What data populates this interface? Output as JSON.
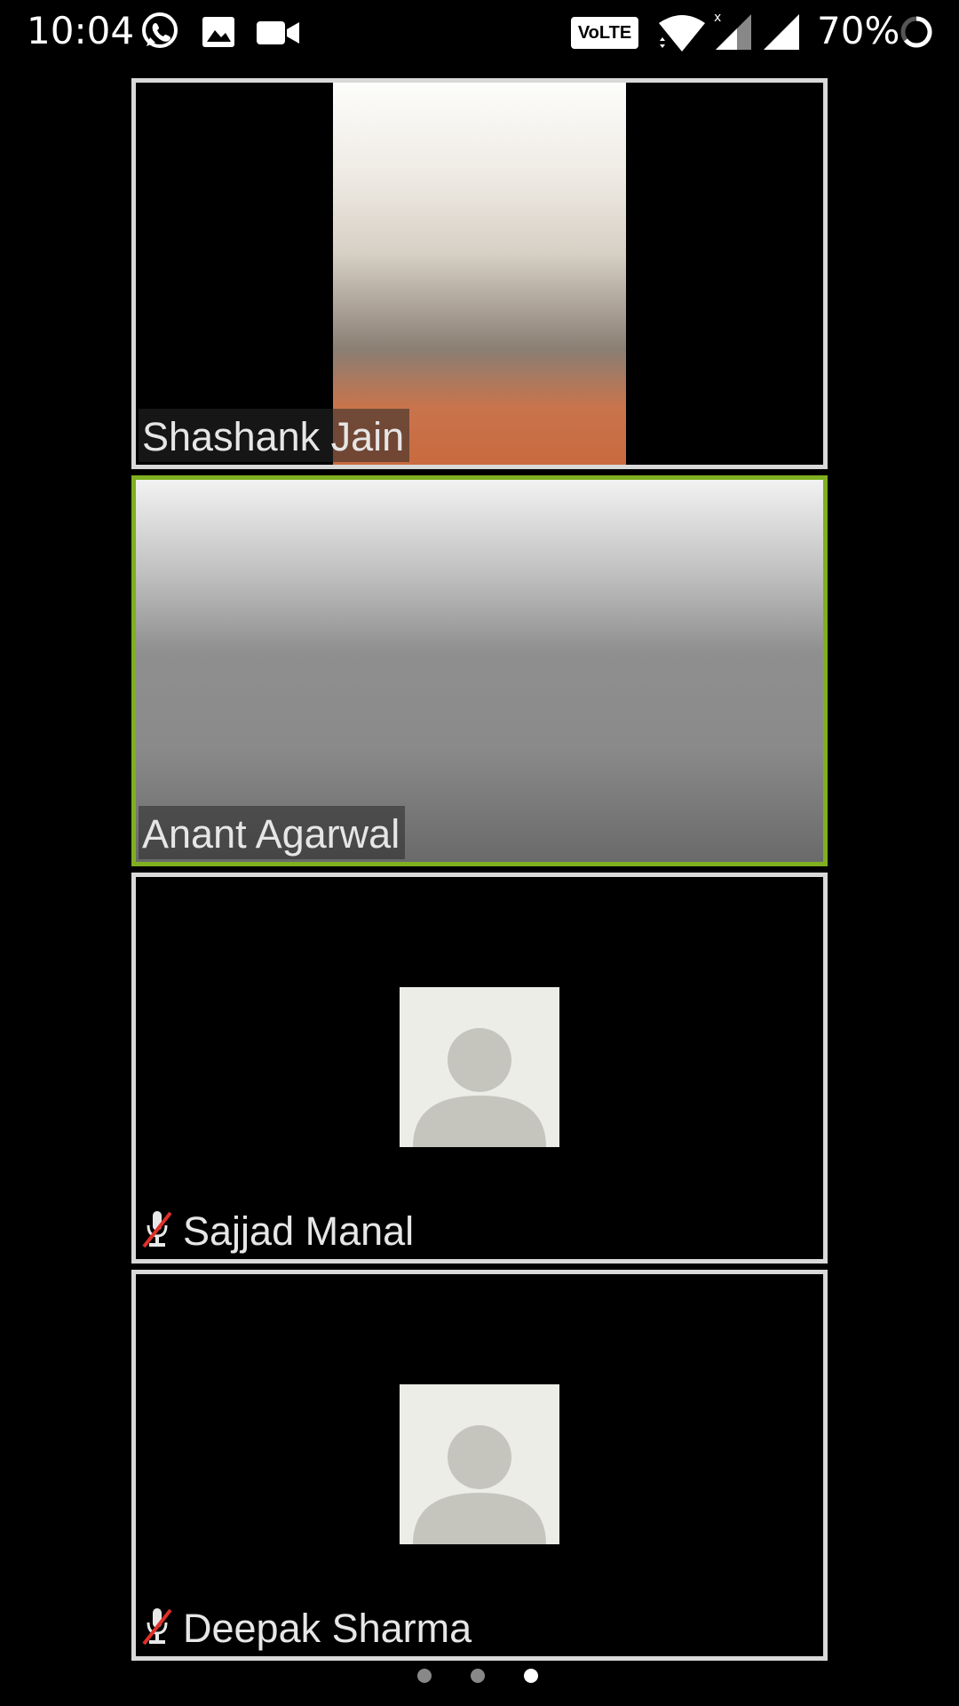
{
  "status_bar": {
    "time": "10:04",
    "volte_label": "VoLTE",
    "battery_percent": "70%"
  },
  "participants": [
    {
      "name": "Shashank Jain",
      "video": "on",
      "muted": false,
      "active_speaker": false
    },
    {
      "name": "Anant Agarwal",
      "video": "on",
      "muted": false,
      "active_speaker": true
    },
    {
      "name": "Sajjad Manal",
      "video": "off",
      "muted": true,
      "active_speaker": false
    },
    {
      "name": "Deepak Sharma",
      "video": "off",
      "muted": true,
      "active_speaker": false
    }
  ],
  "pager": {
    "pages": 3,
    "current_page": 3
  },
  "colors": {
    "active_border": "#7fb01f",
    "tile_border": "#d9d9d9",
    "background": "#000000"
  }
}
